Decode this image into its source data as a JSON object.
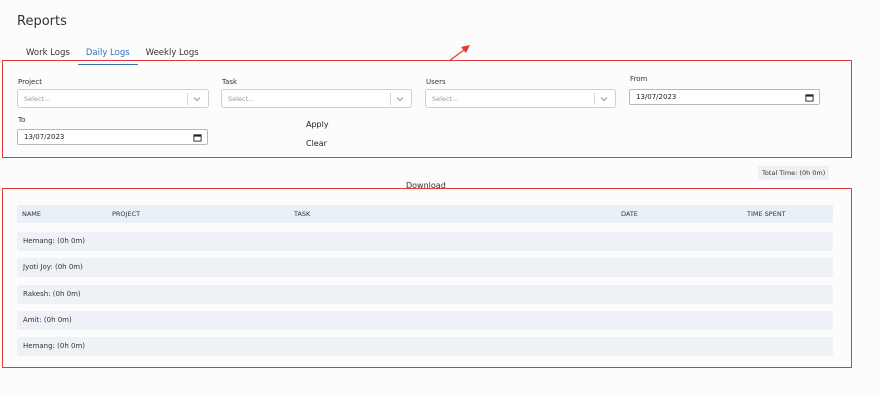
{
  "page": {
    "title": "Reports"
  },
  "tabs": [
    {
      "label": "Work Logs",
      "active": false
    },
    {
      "label": "Daily Logs",
      "active": true
    },
    {
      "label": "Weekly Logs",
      "active": false
    }
  ],
  "filters": {
    "project": {
      "label": "Project",
      "placeholder": "Select..."
    },
    "task": {
      "label": "Task",
      "placeholder": "Select..."
    },
    "users": {
      "label": "Users",
      "placeholder": "Select..."
    },
    "from": {
      "label": "From",
      "value": "13/07/2023"
    },
    "to": {
      "label": "To",
      "value": "13/07/2023"
    }
  },
  "actions": {
    "apply": "Apply",
    "clear": "Clear",
    "download": "Download"
  },
  "summary": {
    "total_time": "Total Time: (0h 0m)"
  },
  "table": {
    "headers": [
      "NAME",
      "PROJECT",
      "TASK",
      "DATE",
      "TIME SPENT"
    ],
    "rows": [
      "Hemang: (0h 0m)",
      "Jyoti Joy: (0h 0m)",
      "Rakesh: (0h 0m)",
      "Amit: (0h 0m)",
      "Hemang: (0h 0m)"
    ]
  },
  "colors": {
    "accent": "#3a6fb0",
    "annotation": "#e23a3a",
    "row_bg": "#eef1f6"
  },
  "icons": {
    "select_chevron": "chevron-down-icon",
    "date_picker": "calendar-icon",
    "annotation_arrow": "arrow-icon"
  }
}
